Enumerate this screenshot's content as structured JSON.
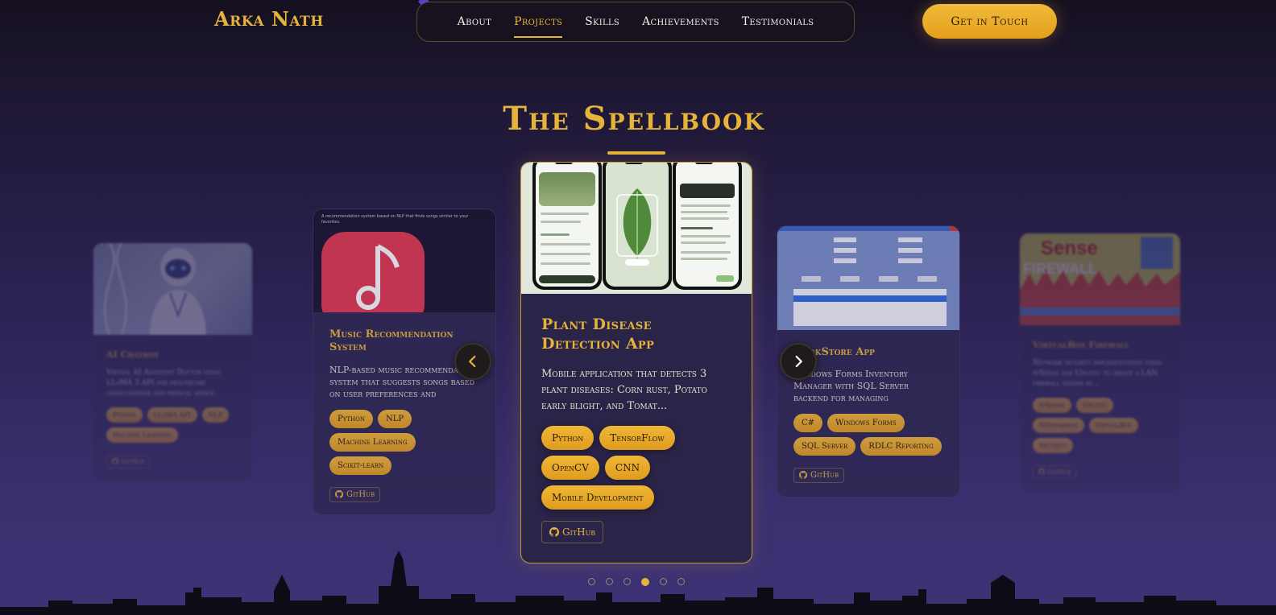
{
  "nav": {
    "logo": "Arka Nath",
    "links": [
      "About",
      "Projects",
      "Skills",
      "Achievements",
      "Testimonials"
    ],
    "active_link": "Projects",
    "cta_label": "Get in Touch"
  },
  "section": {
    "title": "The Spellbook"
  },
  "projects": [
    {
      "title": "AI Chatbot",
      "description": "Virtual AI Assistant Doctor using LLaMA 3 API for healthcare consultations and medical advice.",
      "tags": [
        "Python",
        "LLaMA API",
        "NLP",
        "Machine Learning"
      ],
      "link_label": "GitHub"
    },
    {
      "title": "Music Recommendation System",
      "description": "NLP-based music recommendation system that suggests songs based on user preferences and listenin...",
      "tags": [
        "Python",
        "NLP",
        "Machine Learning",
        "Scikit-learn"
      ],
      "link_label": "GitHub",
      "thumb_caption": "A recommendation system based on NLP that finds songs similar to your favorites."
    },
    {
      "title": "Plant Disease Detection App",
      "description": "Mobile application that detects 3 plant diseases: Corn rust, Potato early blight, and Tomat...",
      "tags": [
        "Python",
        "TensorFlow",
        "OpenCV",
        "CNN",
        "Mobile Development"
      ],
      "link_label": "GitHub"
    },
    {
      "title": "BookStore App",
      "description": "Windows Forms Inventory Manager with SQL Server backend for managing bookstore...",
      "tags": [
        "C#",
        "Windows Forms",
        "SQL Server",
        "RDLC Reporting"
      ],
      "link_label": "GitHub"
    },
    {
      "title": "VirtualBox Firewall",
      "description": "Network security implementation using pfSense and Ubuntu to create a LAN firewall system in...",
      "tags": [
        "pfSense",
        "Ubuntu",
        "Networking",
        "VirtualBox",
        "Security"
      ],
      "link_label": "GitHub",
      "thumb_text": [
        "Sense",
        "FIREWALL"
      ]
    }
  ],
  "carousel": {
    "dot_count": 6,
    "active_index": 3
  },
  "colors": {
    "accent": "#e6b43a",
    "background_top": "#15101f",
    "background_bottom": "#3d3275",
    "card": "#2e2852"
  },
  "icons": {
    "prev": "chevron-left-icon",
    "next": "chevron-right-icon",
    "github": "github-icon"
  }
}
